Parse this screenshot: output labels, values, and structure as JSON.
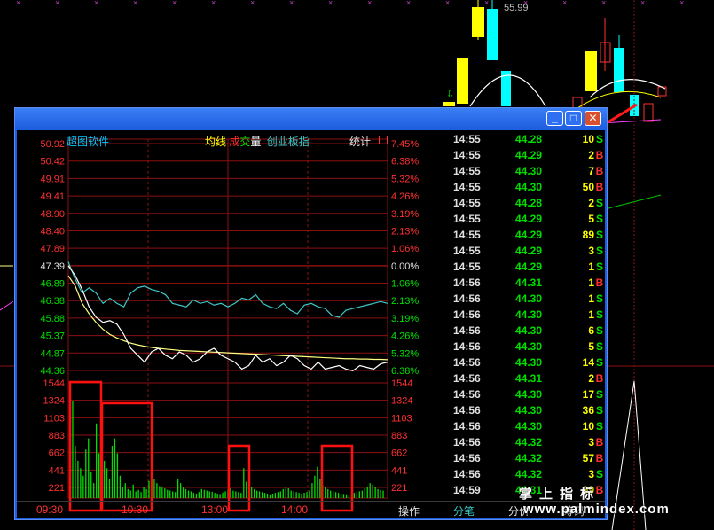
{
  "background_chart": {
    "price_label": "55.99"
  },
  "window": {
    "buttons": {
      "min": "_",
      "max": "□",
      "close": "✕"
    },
    "header": {
      "app_name": "超图软件",
      "legend_junxian": "均线",
      "legend_cheng": "成",
      "legend_jiao": "交",
      "legend_liang": "量",
      "legend_index": "创业板指",
      "stats": "统计"
    },
    "colors": {
      "up": "#ff3030",
      "down": "#00e000",
      "grid": "#8b1010",
      "price_line": "#ffffff",
      "avg_line": "#ffff80",
      "index_line": "#3cc8c8",
      "highlight_box": "#ff1010"
    }
  },
  "chart_data": {
    "type": "line",
    "price_ticks_left": [
      "50.92",
      "50.42",
      "49.91",
      "49.41",
      "48.90",
      "48.40",
      "47.89",
      "47.39",
      "46.89",
      "46.38",
      "45.88",
      "45.37",
      "44.87",
      "44.36"
    ],
    "pct_ticks_right": [
      "7.45%",
      "6.38%",
      "5.32%",
      "4.26%",
      "3.19%",
      "2.13%",
      "1.06%",
      "0.00%",
      "1.06%",
      "2.13%",
      "3.19%",
      "4.26%",
      "5.32%",
      "6.38%"
    ],
    "volume_ticks": [
      "1544",
      "1324",
      "1103",
      "883",
      "662",
      "441",
      "221"
    ],
    "x_labels": [
      "09:30",
      "10:30",
      "13:00",
      "14:00"
    ],
    "prev_close": 47.39,
    "ylim": [
      44.36,
      50.92
    ],
    "price_series": [
      47.39,
      47.1,
      46.7,
      46.2,
      45.9,
      45.75,
      45.8,
      45.7,
      45.4,
      45.0,
      44.8,
      44.6,
      44.9,
      45.0,
      44.8,
      44.7,
      44.9,
      44.8,
      44.6,
      44.7,
      44.9,
      45.0,
      44.8,
      44.7,
      44.6,
      44.4,
      44.5,
      44.8,
      44.6,
      44.7,
      44.5,
      44.6,
      44.8,
      44.7,
      44.5,
      44.4,
      44.6,
      44.4,
      44.45,
      44.5,
      44.4,
      44.35,
      44.5,
      44.45,
      44.4,
      44.55,
      44.6
    ],
    "avg_series": [
      47.1,
      46.8,
      46.3,
      46.0,
      45.75,
      45.55,
      45.4,
      45.3,
      45.22,
      45.15,
      45.1,
      45.06,
      45.03,
      45.0,
      44.98,
      44.96,
      44.94,
      44.93,
      44.92,
      44.91,
      44.9,
      44.89,
      44.88,
      44.87,
      44.86,
      44.85,
      44.84,
      44.83,
      44.82,
      44.81,
      44.8,
      44.79,
      44.78,
      44.77,
      44.76,
      44.75,
      44.74,
      44.73,
      44.72,
      44.71,
      44.7,
      44.7,
      44.69,
      44.69,
      44.68,
      44.68,
      44.67
    ],
    "index_series": [
      47.5,
      47.0,
      46.6,
      46.75,
      46.6,
      46.3,
      46.45,
      46.3,
      46.2,
      46.6,
      46.75,
      46.8,
      46.7,
      46.65,
      46.55,
      46.3,
      46.25,
      46.2,
      46.4,
      46.3,
      46.35,
      46.25,
      46.3,
      46.2,
      46.3,
      46.45,
      46.4,
      46.55,
      46.3,
      46.2,
      46.15,
      46.3,
      46.1,
      46.0,
      46.25,
      46.3,
      46.2,
      46.15,
      45.95,
      45.9,
      46.1,
      46.15,
      46.2,
      46.25,
      46.3,
      46.35,
      46.3
    ],
    "volume": [
      900,
      1300,
      700,
      500,
      400,
      300,
      650,
      800,
      350,
      200,
      1000,
      600,
      700,
      500,
      400,
      250,
      700,
      800,
      600,
      300,
      150,
      200,
      120,
      100,
      180,
      90,
      110,
      80,
      150,
      120,
      230,
      300,
      250,
      200,
      160,
      140,
      130,
      110,
      100,
      90,
      80,
      250,
      200,
      140,
      120,
      100,
      90,
      70,
      60,
      80,
      120,
      110,
      100,
      90,
      85,
      70,
      60,
      55,
      75,
      90,
      110,
      130,
      100,
      90,
      80,
      70,
      400,
      220,
      180,
      150,
      120,
      100,
      90,
      80,
      70,
      60,
      50,
      60,
      70,
      80,
      90,
      120,
      150,
      130,
      100,
      90,
      80,
      70,
      60,
      70,
      80,
      100,
      200,
      300,
      420,
      250,
      180,
      150,
      120,
      100,
      90,
      80,
      70,
      60,
      55,
      50,
      45,
      60,
      70,
      80,
      90,
      100,
      130,
      150,
      200,
      180,
      150,
      120,
      110,
      100
    ],
    "highlight_boxes": [
      "09:30-10:00",
      "10:00-11:30",
      "13:00-13:15",
      "14:30-14:45"
    ]
  },
  "ticks": [
    {
      "time": "14:55",
      "price": "44.28",
      "vol": "10",
      "dir": "S"
    },
    {
      "time": "14:55",
      "price": "44.29",
      "vol": "2",
      "dir": "B"
    },
    {
      "time": "14:55",
      "price": "44.30",
      "vol": "7",
      "dir": "B"
    },
    {
      "time": "14:55",
      "price": "44.30",
      "vol": "50",
      "dir": "B"
    },
    {
      "time": "14:55",
      "price": "44.28",
      "vol": "2",
      "dir": "S"
    },
    {
      "time": "14:55",
      "price": "44.29",
      "vol": "5",
      "dir": "S"
    },
    {
      "time": "14:55",
      "price": "44.29",
      "vol": "89",
      "dir": "S"
    },
    {
      "time": "14:55",
      "price": "44.29",
      "vol": "3",
      "dir": "S"
    },
    {
      "time": "14:55",
      "price": "44.29",
      "vol": "1",
      "dir": "S"
    },
    {
      "time": "14:56",
      "price": "44.31",
      "vol": "1",
      "dir": "B"
    },
    {
      "time": "14:56",
      "price": "44.30",
      "vol": "1",
      "dir": "S"
    },
    {
      "time": "14:56",
      "price": "44.30",
      "vol": "1",
      "dir": "S"
    },
    {
      "time": "14:56",
      "price": "44.30",
      "vol": "6",
      "dir": "S"
    },
    {
      "time": "14:56",
      "price": "44.30",
      "vol": "5",
      "dir": "S"
    },
    {
      "time": "14:56",
      "price": "44.30",
      "vol": "14",
      "dir": "S"
    },
    {
      "time": "14:56",
      "price": "44.31",
      "vol": "2",
      "dir": "B"
    },
    {
      "time": "14:56",
      "price": "44.30",
      "vol": "17",
      "dir": "S"
    },
    {
      "time": "14:56",
      "price": "44.30",
      "vol": "36",
      "dir": "S"
    },
    {
      "time": "14:56",
      "price": "44.30",
      "vol": "10",
      "dir": "S"
    },
    {
      "time": "14:56",
      "price": "44.32",
      "vol": "3",
      "dir": "B"
    },
    {
      "time": "14:56",
      "price": "44.32",
      "vol": "57",
      "dir": "B"
    },
    {
      "time": "14:56",
      "price": "44.32",
      "vol": "3",
      "dir": "S"
    },
    {
      "time": "14:59",
      "price": "44.31",
      "vol": "99",
      "dir": "B"
    }
  ],
  "tabs": [
    "操作",
    "分笔",
    "分价",
    "筹码"
  ],
  "watermark": {
    "cn": "掌上指标",
    "url": "www.palmindex.com"
  }
}
